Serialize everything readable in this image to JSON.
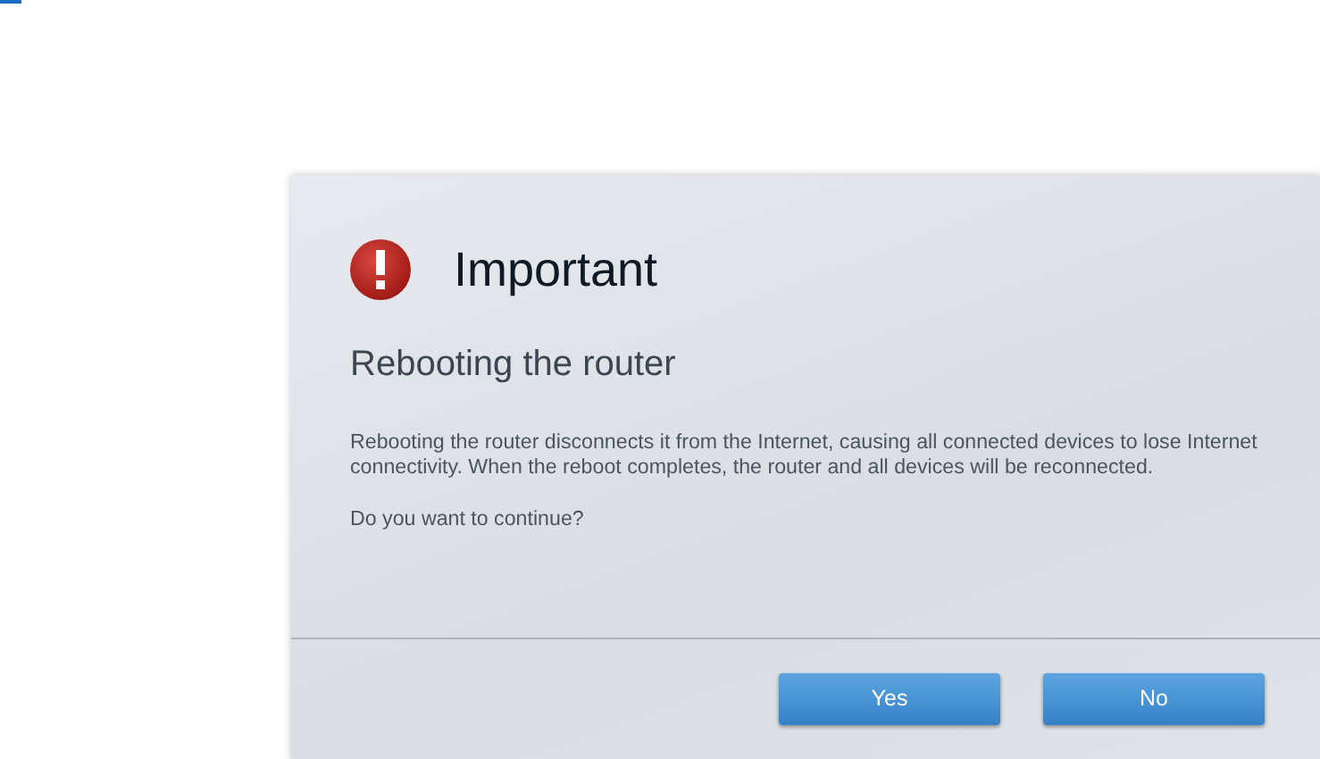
{
  "dialog": {
    "title": "Important",
    "heading": "Rebooting the router",
    "message": "Rebooting the router disconnects it from the Internet, causing all connected devices to lose Internet connectivity. When the reboot completes, the router and all devices will be reconnected.",
    "question": "Do you want to continue?",
    "buttons": [
      "Yes",
      "No"
    ]
  }
}
